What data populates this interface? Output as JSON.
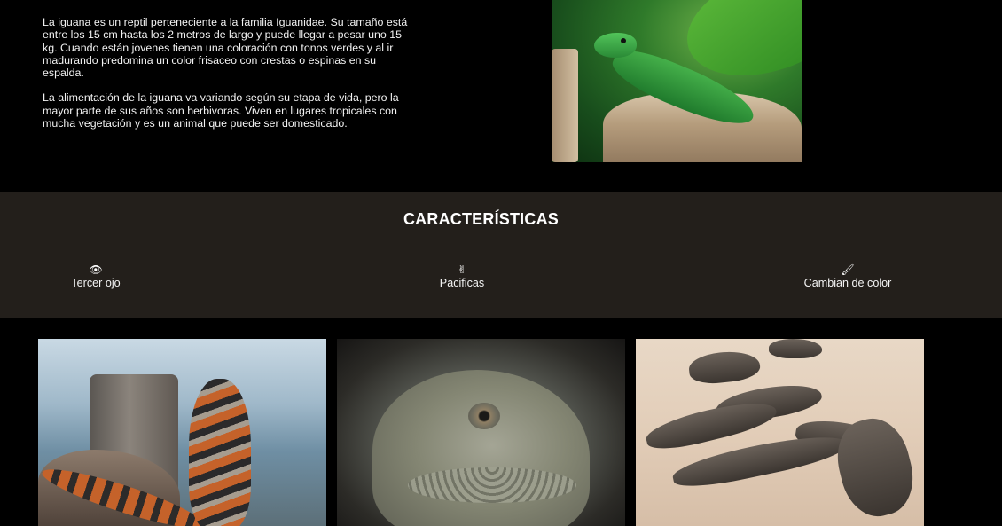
{
  "intro": {
    "paragraphs": [
      "La iguana es un reptil perteneciente a la familia Iguanidae. Su tamaño está entre los 15 cm hasta los 2 metros de largo y puede llegar a pesar uno 15 kg. Cuando están jovenes tienen una coloración con tonos verdes y al ir madurando predomina un color frisaceo con crestas o espinas en su espalda.",
      "La alimentación de la iguana va variando según su etapa de vida, pero la mayor parte de sus años son herbivoras. Viven en lugares tropicales con mucha vegetación y es un animal que puede ser domesticado."
    ]
  },
  "features": {
    "title": "CARACTERÍSTICAS",
    "items": [
      {
        "icon": "eye-icon",
        "glyph": "👁",
        "label": "Tercer ojo"
      },
      {
        "icon": "peace-hand-icon",
        "glyph": "✌",
        "label": "Pacificas"
      },
      {
        "icon": "paint-brush-icon",
        "glyph": "🖌",
        "label": "Cambian de color"
      }
    ]
  },
  "colors": {
    "page_background": "#000000",
    "features_background": "#231f1b",
    "text": "#ffffff"
  }
}
